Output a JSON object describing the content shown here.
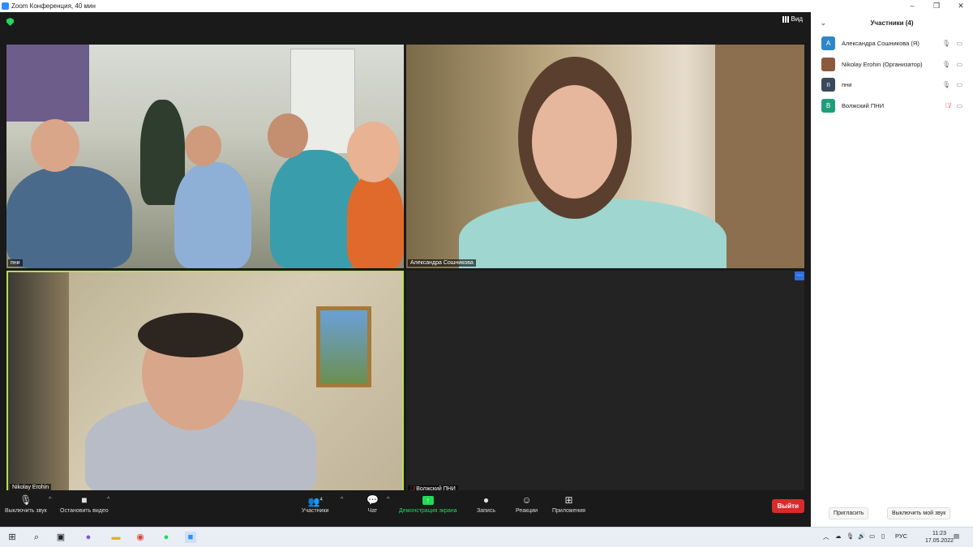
{
  "window": {
    "title": "Zoom Конференция, 40 мин",
    "controls": [
      "–",
      "❐",
      "✕"
    ]
  },
  "meeting": {
    "view_label": "Вид"
  },
  "tiles": [
    {
      "name": "пни"
    },
    {
      "name": "Александра Сошникова"
    },
    {
      "name": "Nikolay Erohin"
    },
    {
      "name": "Волжский ПНИ",
      "muted": true
    }
  ],
  "toolbar": {
    "mute_label": "Выключить звук",
    "video_label": "Остановить видео",
    "participants_label": "Участники",
    "participants_count": "4",
    "chat_label": "Чат",
    "share_label": "Демонстрация экрана",
    "record_label": "Запись",
    "reactions_label": "Реакции",
    "apps_label": "Приложения",
    "leave_label": "Выйти"
  },
  "panel": {
    "title": "Участники (4)",
    "participants": [
      {
        "initial": "А",
        "name": "Александра Сошникова (Я)",
        "color": "#2e86c9",
        "muted": false
      },
      {
        "initial": "",
        "name": "Nikolay Erohin (Организатор)",
        "color": "#8b5a3c",
        "muted": false
      },
      {
        "initial": "п",
        "name": "пни",
        "color": "#3a4a5c",
        "muted": false
      },
      {
        "initial": "В",
        "name": "Волжский ПНИ",
        "color": "#1f9e7d",
        "muted": true
      }
    ],
    "invite_label": "Пригласить",
    "mute_me_label": "Выключить мой звук"
  },
  "taskbar": {
    "lang": "РУС",
    "time": "11:23",
    "date": "17.05.2022"
  }
}
